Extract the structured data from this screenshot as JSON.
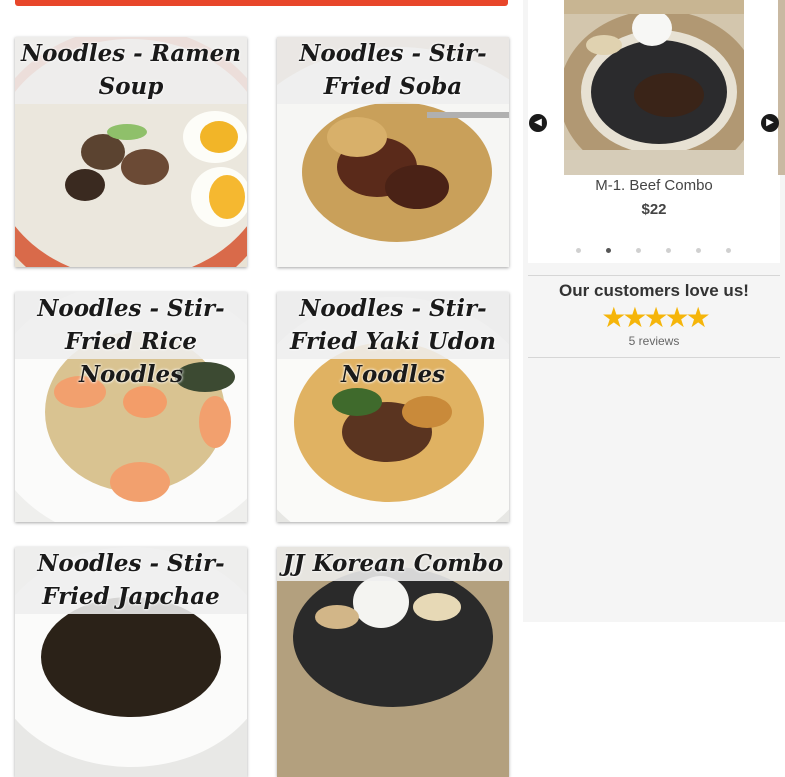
{
  "menu_cards": [
    {
      "title": "Noodles - Ramen Soup"
    },
    {
      "title": "Noodles - Stir-Fried Soba"
    },
    {
      "title": "Noodles - Stir-Fried Rice Noodles"
    },
    {
      "title": "Noodles - Stir-Fried Yaki Udon Noodles"
    },
    {
      "title": "Noodles - Stir-Fried Japchae"
    },
    {
      "title": "JJ Korean Combo"
    }
  ],
  "carousel": {
    "item_name": "M-1. Beef Combo",
    "item_price": "$22",
    "prev_icon": "chevron-left-icon",
    "next_icon": "chevron-right-icon",
    "slide_count": 6,
    "active_slide": 2
  },
  "reviews": {
    "title": "Our customers love us!",
    "rating": 5,
    "count_text": "5 reviews"
  },
  "colors": {
    "accent": "#e8462a",
    "star": "#f5b50a"
  }
}
